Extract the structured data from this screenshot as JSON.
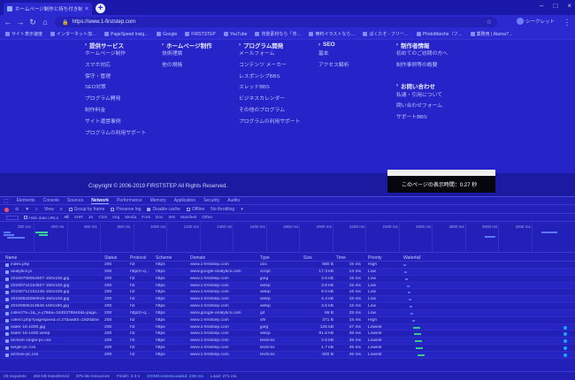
{
  "browser": {
    "tab_title": "ホームページ制作と持ち付き制作サ…",
    "url": "https://www.1-firststep.com",
    "profile": "シークレット"
  },
  "bookmarks": [
    "サイト表示速度",
    "インターネット加…",
    "PageSpeed Insig…",
    "Google",
    "FIRSTSTEP",
    "YouTube",
    "背景素材なら「背…",
    "無料イラストなら…",
    "ぱくたそ - フリー…",
    "PhotoMarche（フ…",
    "業務用 | Alarna?…"
  ],
  "menu": {
    "col1": {
      "title": "提供サービス",
      "links": [
        "ホームページ制作",
        "スマホ対応",
        "保守・管理",
        "SEO対策",
        "プログラム開発",
        "制作料金",
        "サイト運営事例",
        "プログラムの利用サポート"
      ]
    },
    "col2": {
      "title": "ホームページ制作",
      "links": [
        "技術理論",
        "他の規格"
      ]
    },
    "col3": {
      "title": "プログラム開発",
      "links": [
        "メールフォーム",
        "コンテンツ メーカー",
        "レスポンシブBBS",
        "スレッドBBS",
        "ビジネスカレンダー",
        "その他のプログラム",
        "プログラムの利用サポート"
      ]
    },
    "col4": {
      "title": "SEO",
      "links": [
        "基本",
        "アクセス解析"
      ]
    },
    "col5": {
      "title": "制作者情報",
      "links": [
        "初めてのご訪問の方へ",
        "制作事例等の概要"
      ]
    },
    "col6": {
      "title": "お問い合わせ",
      "links": [
        "私達・引用について",
        "問い合わせフォーム",
        "サポートBBS"
      ]
    }
  },
  "footer": {
    "copyright": "Copyright © 2006-2019 FIRSTSTEP All Rights Reserved.",
    "load_time": "このページの表示時間：0.27 秒"
  },
  "devtools": {
    "tabs": [
      "Elements",
      "Console",
      "Sources",
      "Network",
      "Performance",
      "Memory",
      "Application",
      "Security",
      "Audits"
    ],
    "active_tab": "Network",
    "toolbar": [
      "View",
      "Group by frame",
      "Preserve log",
      "Disable cache",
      "Offline",
      "No throttling"
    ],
    "filter_items": [
      "Hide data URLs",
      "All",
      "XHR",
      "JS",
      "CSS",
      "Img",
      "Media",
      "Font",
      "Doc",
      "WS",
      "Manifest",
      "Other"
    ],
    "active_filter": "All",
    "timeline_ticks": [
      "200 ms",
      "400 ms",
      "600 ms",
      "800 ms",
      "1000 ms",
      "1200 ms",
      "1400 ms",
      "1600 ms",
      "1800 ms",
      "2000 ms",
      "2200 ms",
      "2400 ms",
      "2600 ms",
      "2800 ms",
      "3000 ms",
      "3200 ms"
    ],
    "columns": [
      "Name",
      "Status",
      "Protocol",
      "Scheme",
      "Domain",
      "Type",
      "Size",
      "Time",
      "Priority",
      "Waterfall"
    ],
    "rows": [
      [
        "index.php",
        "200",
        "h2",
        "https",
        "www.1-firststep.com",
        "doc",
        "880 B",
        "15 ms",
        "High",
        "false"
      ],
      [
        "analytics.js",
        "200",
        "http/2+q…",
        "https",
        "www.google-analytics.com",
        "script",
        "17.3 kB",
        "13 ms",
        "Low",
        "false"
      ],
      [
        "20190708052607-150x150.jpg",
        "200",
        "h2",
        "https",
        "www.1-firststep.com",
        "jpeg",
        "3.6 kB",
        "15 ms",
        "Low",
        "false"
      ],
      [
        "20190724154927-150x150.jpg",
        "200",
        "h2",
        "https",
        "www.1-firststep.com",
        "webp",
        "3.6 kB",
        "15 ms",
        "Low",
        "false"
      ],
      [
        "20190712151245-150x150.jpg",
        "200",
        "h2",
        "https",
        "www.1-firststep.com",
        "webp",
        "8.0 kB",
        "16 ms",
        "Low",
        "false"
      ],
      [
        "20190626050919-150x150.jpg",
        "200",
        "h2",
        "https",
        "www.1-firststep.com",
        "webp",
        "4.4 kB",
        "15 ms",
        "Low",
        "false"
      ],
      [
        "20190606113846-150x150.jpg",
        "200",
        "h2",
        "https",
        "www.1-firststep.com",
        "webp",
        "3.5 kB",
        "15 ms",
        "Low",
        "false"
      ],
      [
        "collect?v=1&_v=j79&a=1845378944&t=page…",
        "200",
        "http/2+q…",
        "https",
        "www.google-analytics.com",
        "gif",
        "66 B",
        "25 ms",
        "Low",
        "false"
      ],
      [
        "collect.php?pagespeed=0.27&width=1920&he…",
        "200",
        "h2",
        "https",
        "www.1-firststep.com",
        "xhr",
        "371 B",
        "15 ms",
        "High",
        "false"
      ],
      [
        "slider-16-1600.jpg",
        "200",
        "h2",
        "https",
        "www.1-firststep.com",
        "jpeg",
        "125 kB",
        "47 ms",
        "Lowest",
        "true"
      ],
      [
        "slider-16-1600.webp",
        "200",
        "h2",
        "https",
        "www.1-firststep.com",
        "webp",
        "91.6 kB",
        "48 ms",
        "Lowest",
        "true"
      ],
      [
        "archive-single-pc.css",
        "200",
        "h2",
        "https",
        "www.1-firststep.com",
        "text/css",
        "2.6 kB",
        "45 ms",
        "Lowest",
        "true"
      ],
      [
        "single-pc.css",
        "200",
        "h2",
        "https",
        "www.1-firststep.com",
        "text/css",
        "1.7 kB",
        "45 ms",
        "Lowest",
        "true"
      ],
      [
        "archive-pc.css",
        "200",
        "h2",
        "https",
        "www.1-firststep.com",
        "text/css",
        "820 B",
        "45 ms",
        "Lowest",
        "true"
      ]
    ],
    "status": {
      "requests": "20 requests",
      "transferred": "259 kB transferred",
      "resources": "375 kB resources",
      "finish": "Finish: 2.0 s",
      "dcl": "DOMContentLoaded: 239 ms",
      "load": "Load: 271 ms"
    }
  }
}
